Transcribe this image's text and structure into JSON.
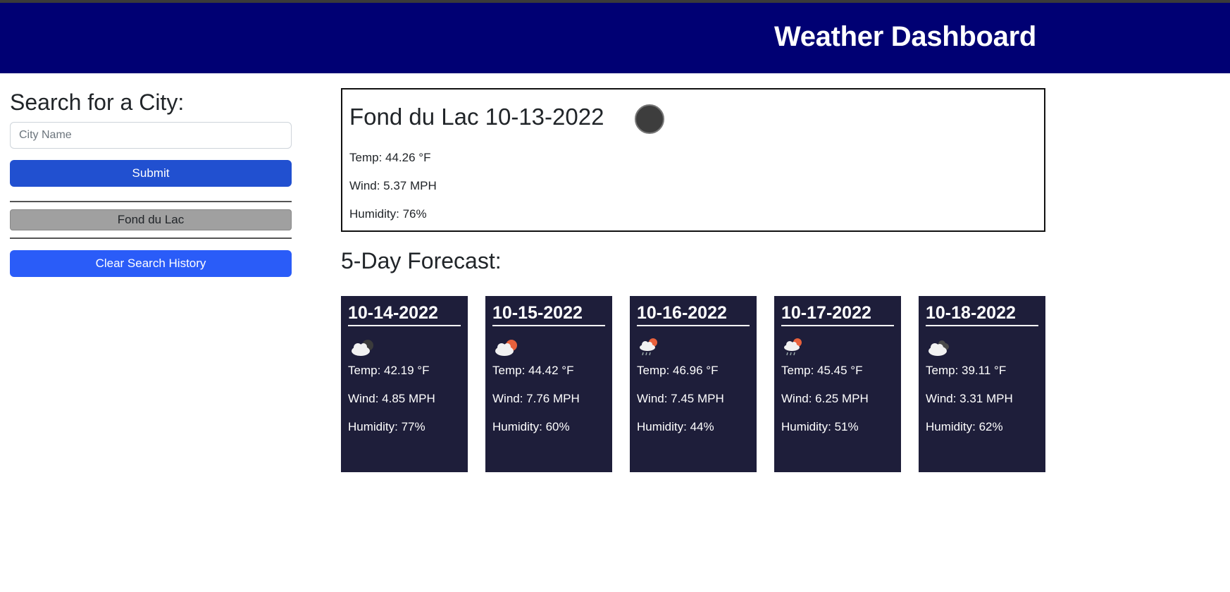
{
  "header": {
    "title": "Weather Dashboard"
  },
  "sidebar": {
    "heading": "Search for a City:",
    "input_placeholder": "City Name",
    "input_value": "",
    "submit_label": "Submit",
    "history": [
      {
        "label": "Fond du Lac"
      }
    ],
    "clear_label": "Clear Search History"
  },
  "current": {
    "title": "Fond du Lac 10-13-2022",
    "icon": "dark-circle-icon",
    "temp": "Temp: 44.26 °F",
    "wind": "Wind: 5.37 MPH",
    "humidity": "Humidity: 76%"
  },
  "forecast": {
    "title": "5-Day Forecast:",
    "days": [
      {
        "date": "10-14-2022",
        "icon": "cloudy-night-icon",
        "temp": "Temp: 42.19 °F",
        "wind": "Wind: 4.85 MPH",
        "humidity": "Humidity: 77%"
      },
      {
        "date": "10-15-2022",
        "icon": "partly-cloudy-icon",
        "temp": "Temp: 44.42 °F",
        "wind": "Wind: 7.76 MPH",
        "humidity": "Humidity: 60%"
      },
      {
        "date": "10-16-2022",
        "icon": "rain-sun-icon",
        "temp": "Temp: 46.96 °F",
        "wind": "Wind: 7.45 MPH",
        "humidity": "Humidity: 44%"
      },
      {
        "date": "10-17-2022",
        "icon": "rain-sun-icon",
        "temp": "Temp: 45.45 °F",
        "wind": "Wind: 6.25 MPH",
        "humidity": "Humidity: 51%"
      },
      {
        "date": "10-18-2022",
        "icon": "broken-clouds-icon",
        "temp": "Temp: 39.11 °F",
        "wind": "Wind: 3.31 MPH",
        "humidity": "Humidity: 62%"
      }
    ]
  },
  "colors": {
    "header_bg": "#000073",
    "card_bg": "#1e1e3a",
    "submit_bg": "#2150d0",
    "clear_bg": "#2a5cf8",
    "history_bg": "#a0a0a0"
  }
}
